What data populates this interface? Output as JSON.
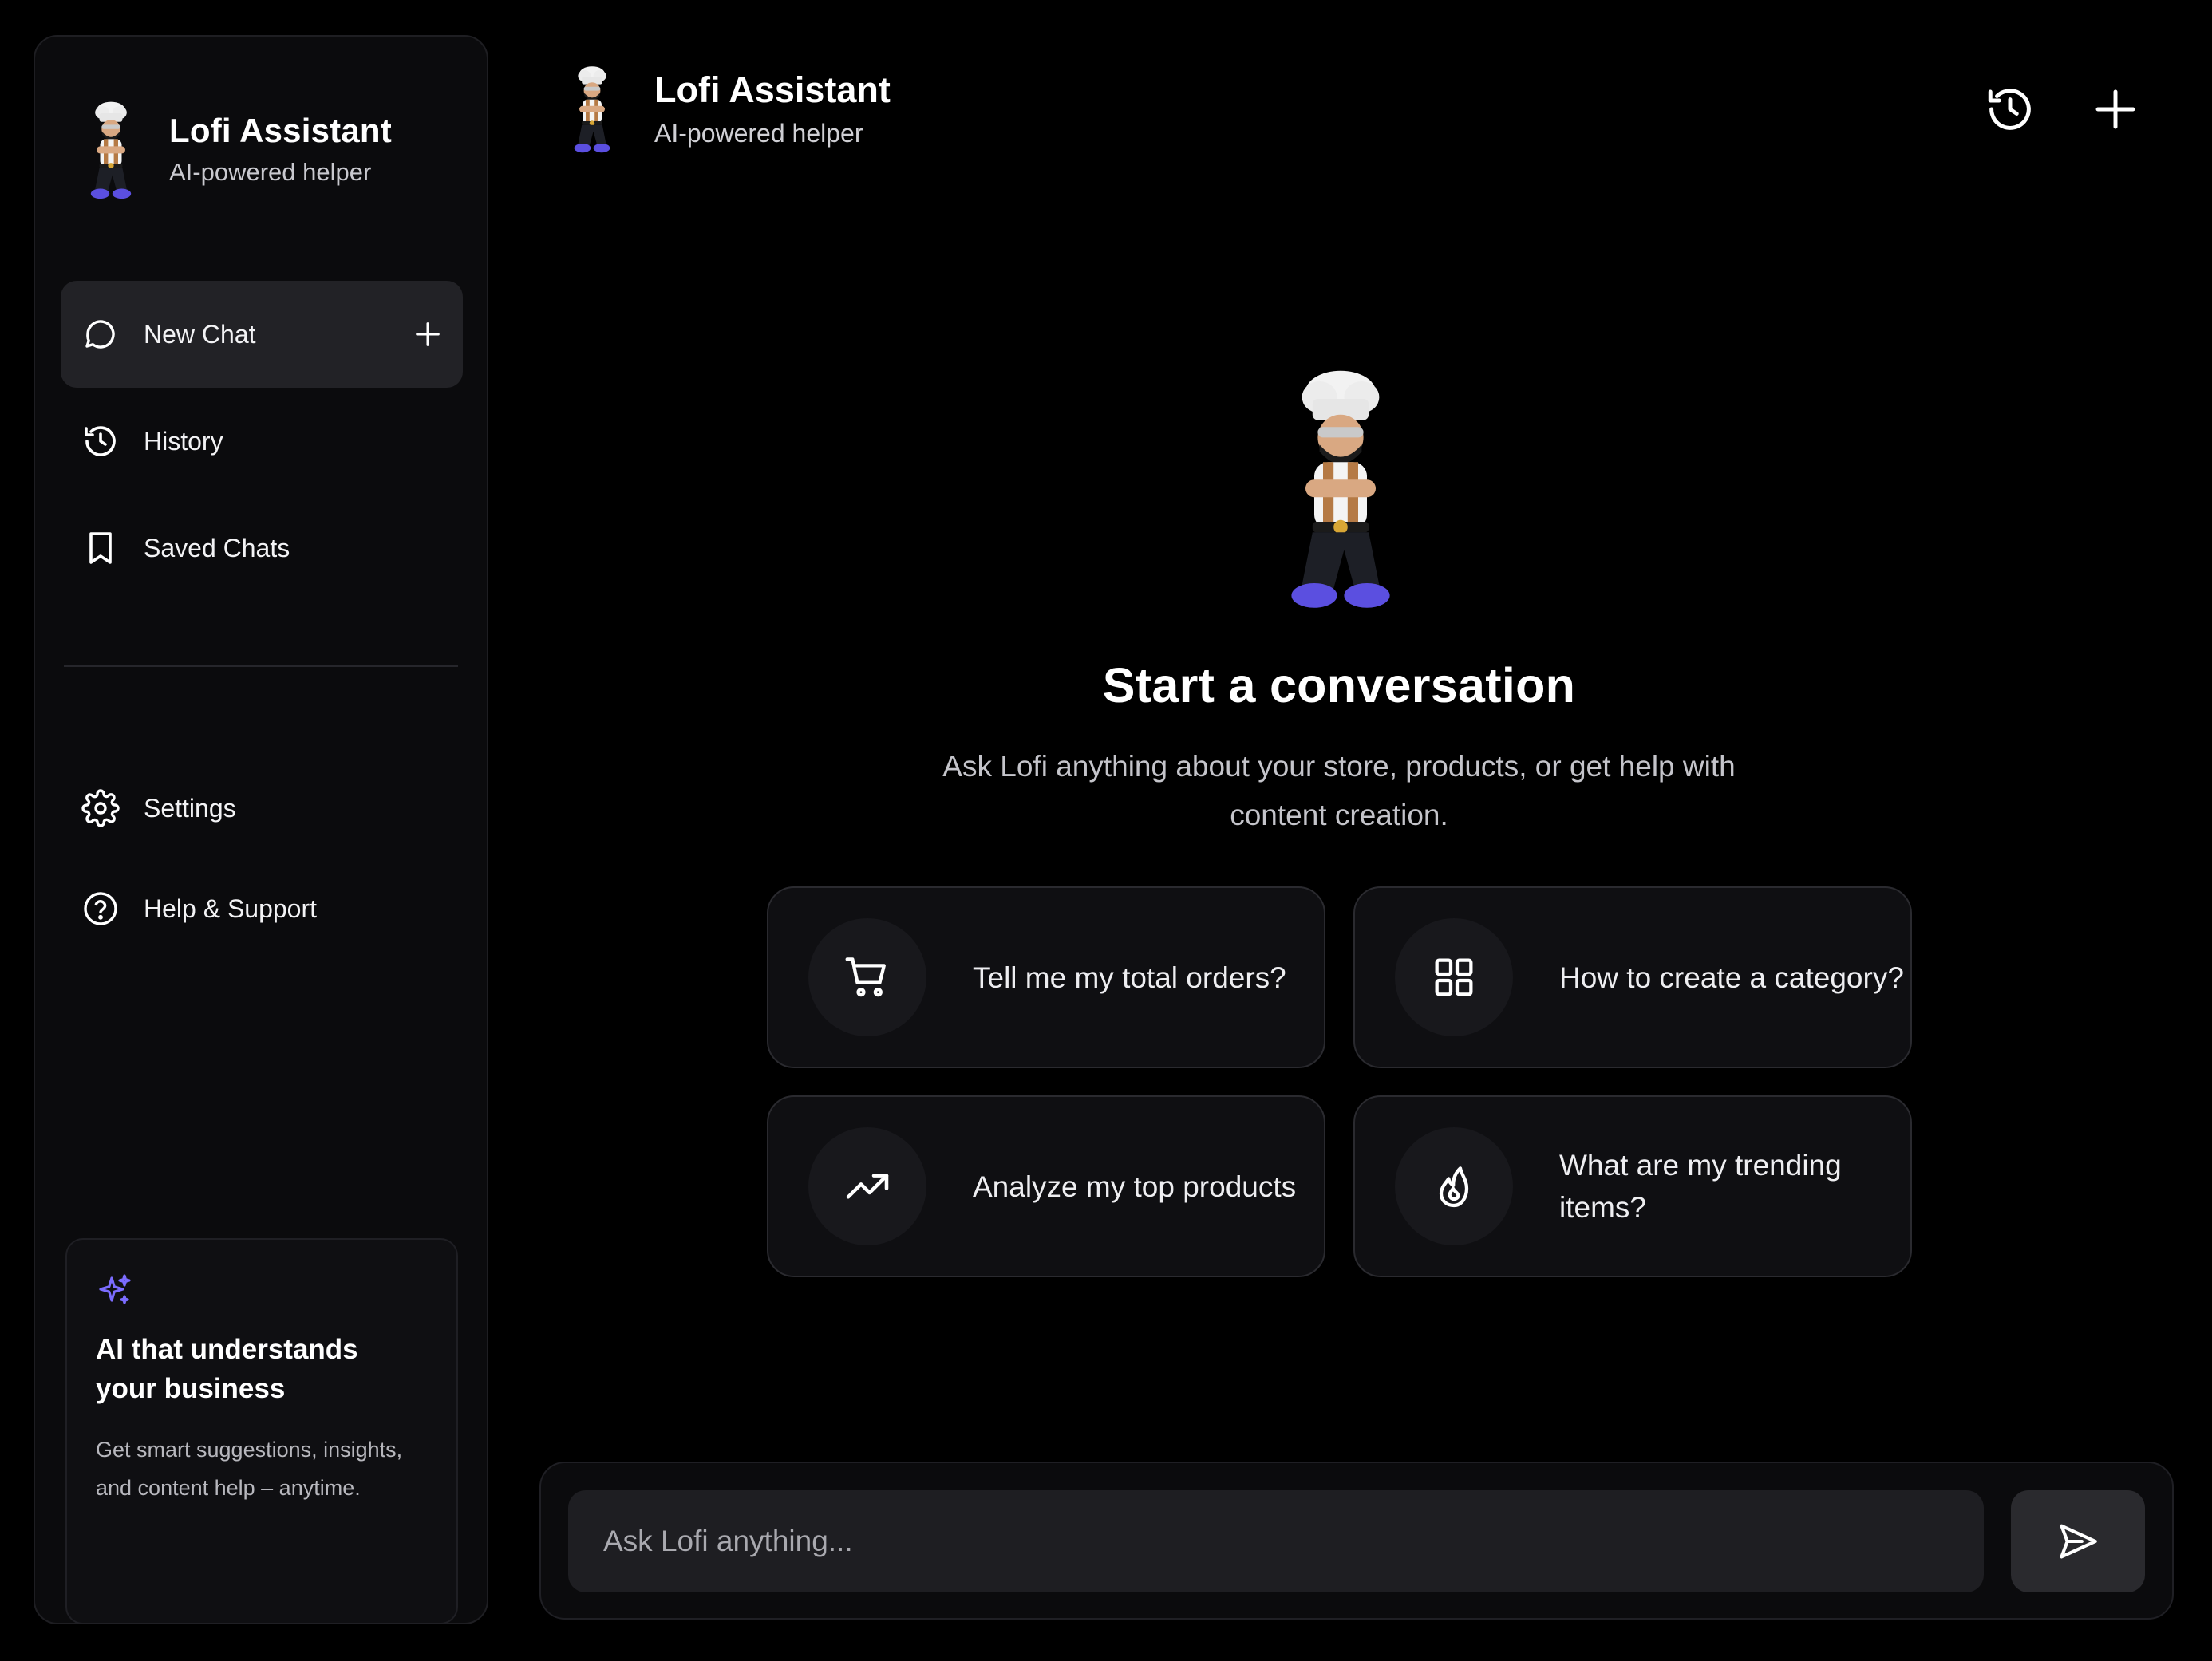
{
  "sidebar": {
    "brand": {
      "title": "Lofi Assistant",
      "subtitle": "AI-powered helper",
      "avatar": "chef-mascot"
    },
    "items": [
      {
        "label": "New Chat",
        "icon": "chat-bubble-icon",
        "action_icon": "plus-icon",
        "active": true
      },
      {
        "label": "History",
        "icon": "history-icon"
      },
      {
        "label": "Saved Chats",
        "icon": "bookmark-icon"
      }
    ],
    "secondary_items": [
      {
        "label": "Settings",
        "icon": "gear-icon"
      },
      {
        "label": "Help & Support",
        "icon": "help-circle-icon"
      }
    ],
    "promo": {
      "icon": "sparkles-icon",
      "title": "AI that understands your business",
      "text": "Get smart suggestions, insights, and content help – anytime."
    }
  },
  "header": {
    "title": "Lofi Assistant",
    "subtitle": "AI-powered helper",
    "actions": [
      {
        "name": "history",
        "icon": "history-icon"
      },
      {
        "name": "new-chat",
        "icon": "plus-icon"
      }
    ]
  },
  "hero": {
    "title": "Start a conversation",
    "subtitle": "Ask Lofi anything about your store, products, or get help with content creation."
  },
  "suggestions": [
    {
      "label": "Tell me my total orders?",
      "icon": "cart-icon"
    },
    {
      "label": "How to create a category?",
      "icon": "grid-icon"
    },
    {
      "label": "Analyze my top products",
      "icon": "trending-up-icon"
    },
    {
      "label": "What are my trending items?",
      "icon": "flame-icon"
    }
  ],
  "composer": {
    "placeholder": "Ask Lofi anything...",
    "value": "",
    "send_icon": "send-icon"
  },
  "colors": {
    "background": "#000000",
    "panel": "#0b0b0d",
    "active_item": "#222226",
    "card": "#0f0f12",
    "accent_sparkle": "#7b6cff",
    "mascot_shoes": "#5b4fe0"
  }
}
